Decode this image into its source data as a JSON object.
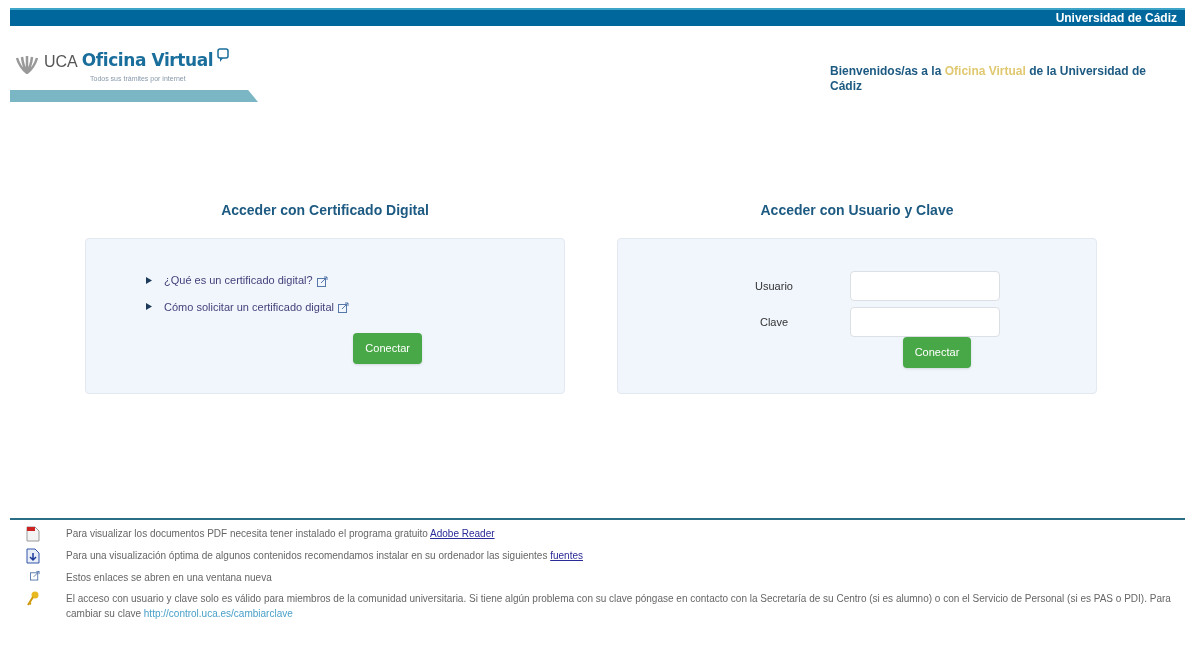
{
  "top_bar": {
    "title": "Universidad de Cádiz"
  },
  "logo": {
    "mark": "UCA",
    "name": "Oficina Virtual",
    "tagline": "Todos sus trámites por internet"
  },
  "welcome": {
    "before": "Bienvenidos/as a la ",
    "highlight": "Oficina Virtual",
    "after": " de la Universidad de Cádiz"
  },
  "certificate_panel": {
    "heading": "Acceder con Certificado Digital",
    "links": [
      "¿Qué es un certificado digital?",
      "Cómo solicitar un certificado digital"
    ],
    "button": "Conectar"
  },
  "login_panel": {
    "heading": "Acceder con Usuario y Clave",
    "fields": [
      {
        "label": "Usuario"
      },
      {
        "label": "Clave"
      }
    ],
    "button": "Conectar"
  },
  "notes": [
    {
      "kind": "pdf",
      "text": "Para visualizar los documentos PDF necesita tener instalado el programa gratuito ",
      "link": "Adobe Reader"
    },
    {
      "kind": "font",
      "text": "Para una visualización óptima de algunos contenidos recomendamos instalar en su ordenador las siguientes ",
      "link": "fuentes"
    },
    {
      "kind": "new_window",
      "text": "Estos enlaces se abren en una ventana nueva"
    },
    {
      "kind": "key",
      "text": "El acceso con usuario y clave solo es válido para miembros de la comunidad universitaria. Si tiene algún problema con su clave póngase en contacto con la Secretaría de su Centro (si es alumno) o con el Servicio de Personal (si es PAS o PDI). Para cambiar su clave ",
      "link": "http://control.uca.es/cambiarclave"
    }
  ]
}
